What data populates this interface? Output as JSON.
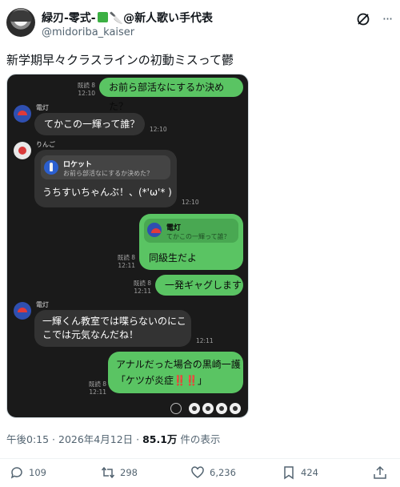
{
  "header": {
    "display_name_prefix": "緑刃-零式-",
    "display_name_suffix": "@新人歌い手代表",
    "handle": "@midoriba_kaiser"
  },
  "tweet": {
    "text": "新学期早々クラスラインの初動ミスって鬱"
  },
  "chat": {
    "msg1": {
      "text": "お前ら部活なにするか決めた？",
      "read": "既読 8",
      "time": "12:10"
    },
    "msg2": {
      "sender": "電灯",
      "text": "てかこの一輝って誰？",
      "time": "12:10"
    },
    "msg3": {
      "sender": "りんご",
      "quote_title": "ロケット",
      "quote_body": "お前ら部活なにするか決めた？",
      "text": "うちすいちゃんぶ！、(*'ω'* )",
      "time": "12:10"
    },
    "msg4": {
      "quote_title": "電灯",
      "quote_body": "てかこの一輝って誰？",
      "text": "同級生だよ",
      "read": "既読 8",
      "time": "12:11"
    },
    "msg5": {
      "text": "一発ギャグします",
      "read": "既読 8",
      "time": "12:11"
    },
    "msg6": {
      "sender": "電灯",
      "text_line1": "一輝くん教室では喋らないのにこ",
      "text_line2": "こでは元気なんだね！",
      "time": "12:11"
    },
    "msg7": {
      "text_line1": "アナルだった場合の黒崎一護",
      "text_line2": "「ケツが炎症‼️‼️」",
      "read": "既読 8",
      "time": "12:11"
    }
  },
  "timeline": {
    "time": "午後0:15 · 2026年4月12日 · ",
    "views": "85.1万",
    "views_suffix": " 件の表示"
  },
  "actions": {
    "replies": "109",
    "reposts": "298",
    "likes": "6,236",
    "bookmarks": "424"
  },
  "colors": {
    "accent_green": "#5ac463",
    "chat_bg": "#1a1a1a",
    "muted": "#536471"
  }
}
